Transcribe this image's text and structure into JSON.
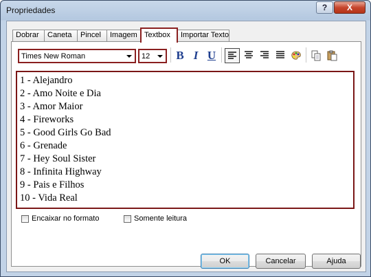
{
  "window": {
    "title": "Propriedades",
    "help_label": "?",
    "close_label": "X"
  },
  "tabs": [
    {
      "label": "Dobrar"
    },
    {
      "label": "Caneta"
    },
    {
      "label": "Pincel"
    },
    {
      "label": "Imagem"
    },
    {
      "label": "Textbox",
      "active": true
    },
    {
      "label": "Importar Texto"
    }
  ],
  "toolbar": {
    "font": {
      "value": "Times New Roman"
    },
    "size": {
      "value": "12"
    },
    "bold_label": "B",
    "italic_label": "I",
    "underline_label": "U",
    "icons": [
      "align-left-icon",
      "align-center-icon",
      "align-right-icon",
      "justify-icon",
      "color-palette-icon",
      "copy-icon",
      "paste-icon"
    ]
  },
  "editor": {
    "lines": [
      "1 - Alejandro",
      "2 - Amo Noite e Dia",
      "3 - Amor Maior",
      "4 - Fireworks",
      "5 - Good Girls Go Bad",
      "6 - Grenade",
      "7 - Hey Soul Sister",
      "8 - Infinita Highway",
      "9 - Pais e Filhos",
      "10 - Vida Real"
    ]
  },
  "options": {
    "fit_label": "Encaixar no formato",
    "readonly_label": "Somente leitura"
  },
  "buttons": {
    "ok": "OK",
    "cancel": "Cancelar",
    "help": "Ajuda"
  },
  "colors": {
    "highlight_border": "#8a1f1f",
    "accent_blue": "#3c7fb1"
  }
}
